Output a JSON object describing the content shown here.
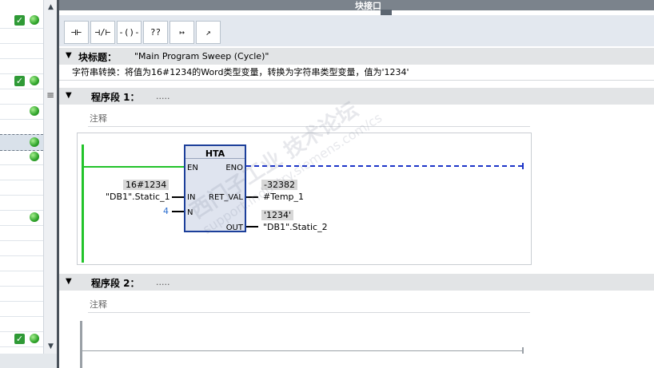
{
  "header": {
    "title": "块接口"
  },
  "left_panel": {
    "rows": [
      {
        "check": true,
        "dot": true
      },
      {
        "check": false,
        "dot": false
      },
      {
        "check": false,
        "dot": false
      },
      {
        "check": false,
        "dot": false
      },
      {
        "check": true,
        "dot": true
      },
      {
        "check": false,
        "dot": false
      },
      {
        "check": false,
        "dot": true
      },
      {
        "check": false,
        "dot": false
      },
      {
        "check": false,
        "dot": true,
        "selected": true
      },
      {
        "check": false,
        "dot": true
      },
      {
        "check": false,
        "dot": false
      },
      {
        "check": false,
        "dot": false
      },
      {
        "check": false,
        "dot": false
      },
      {
        "check": false,
        "dot": true
      },
      {
        "check": false,
        "dot": false
      },
      {
        "check": false,
        "dot": false
      },
      {
        "check": false,
        "dot": false
      },
      {
        "check": false,
        "dot": false
      },
      {
        "check": false,
        "dot": false
      },
      {
        "check": false,
        "dot": false
      },
      {
        "check": false,
        "dot": false
      },
      {
        "check": true,
        "dot": true
      }
    ],
    "scroll_up_icon": "triangle-up",
    "scroll_down_icon": "triangle-down"
  },
  "toolbar": {
    "buttons": [
      {
        "name": "normally-open-contact",
        "glyph": "⊣⊢"
      },
      {
        "name": "normally-closed-contact",
        "glyph": "⊣/⊢"
      },
      {
        "name": "output-coil",
        "glyph": "-()-"
      },
      {
        "name": "empty-box",
        "glyph": "??"
      },
      {
        "name": "open-branch",
        "glyph": "↦"
      },
      {
        "name": "close-branch",
        "glyph": "↗"
      }
    ]
  },
  "block_title": {
    "label": "块标题：",
    "value": "\"Main Program Sweep (Cycle)\"",
    "description": "字符串转换：将值为16#1234的Word类型变量，转换为字符串类型变量，值为'1234'"
  },
  "networks": [
    {
      "label": "程序段 1：",
      "dots": ".....",
      "comment": "注释",
      "block": {
        "name": "HTA",
        "pins_left": [
          "EN",
          "IN",
          "N"
        ],
        "pins_right": [
          "ENO",
          "RET_VAL",
          "OUT"
        ],
        "in_value": "16#1234",
        "in_operand": "\"DB1\".Static_1",
        "n_value": "4",
        "ret_val_value": "-32382",
        "ret_val_operand": "#Temp_1",
        "out_value": "'1234'",
        "out_operand": "\"DB1\".Static_2"
      }
    },
    {
      "label": "程序段 2：",
      "dots": ".....",
      "comment": "注释"
    }
  ],
  "watermark": {
    "line1": "西门子工业 技术论坛",
    "line2": "support.industry.siemens.com/cs"
  },
  "colors": {
    "power_flow": "#22c32a",
    "eno_dashed": "#1c34c8",
    "block_fill": "#dfe4ef",
    "block_border": "#1c3f9a",
    "n_value": "#2e6fd0"
  }
}
